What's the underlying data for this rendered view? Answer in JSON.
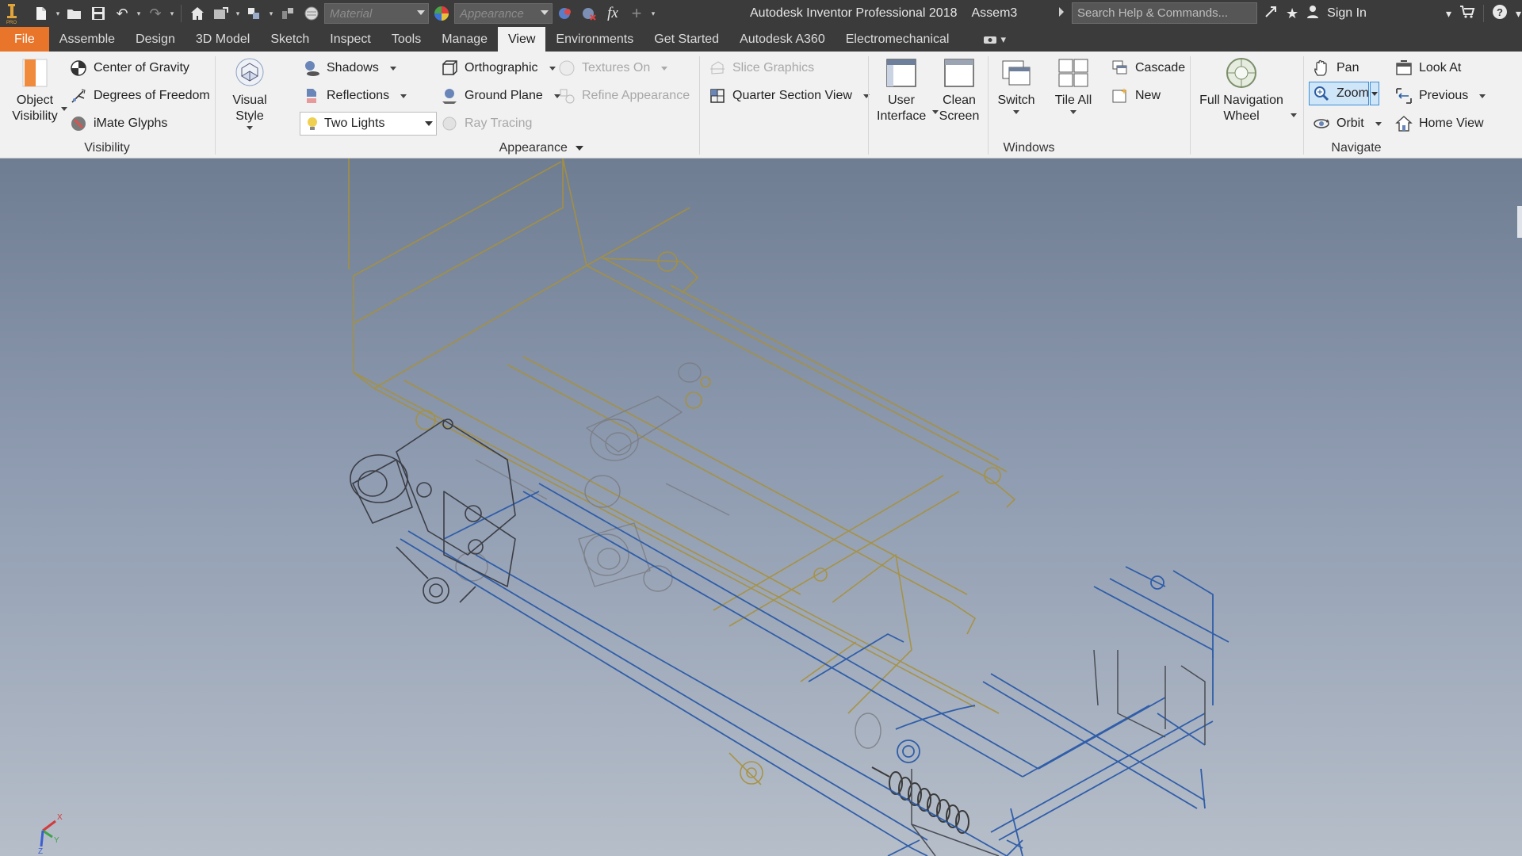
{
  "titlebar": {
    "app_name": "Autodesk Inventor Professional 2018",
    "document": "Assem3",
    "material_placeholder": "Material",
    "appearance_placeholder": "Appearance",
    "search_placeholder": "Search Help & Commands...",
    "sign_in": "Sign In",
    "fx_label": "fx"
  },
  "tabs": [
    "File",
    "Assemble",
    "Design",
    "3D Model",
    "Sketch",
    "Inspect",
    "Tools",
    "Manage",
    "View",
    "Environments",
    "Get Started",
    "Autodesk A360",
    "Electromechanical"
  ],
  "active_tab": "View",
  "ribbon": {
    "visibility": {
      "title": "Visibility",
      "object_visibility": [
        "Object",
        "Visibility"
      ],
      "center_of_gravity": "Center of Gravity",
      "degrees_of_freedom": "Degrees of Freedom",
      "imate_glyphs": "iMate Glyphs"
    },
    "appearance": {
      "title": "Appearance",
      "visual_style": "Visual Style",
      "shadows": "Shadows",
      "reflections": "Reflections",
      "lighting": "Two Lights",
      "orthographic": "Orthographic",
      "ground_plane": "Ground Plane",
      "textures_on": "Textures On",
      "refine_appearance": "Refine Appearance",
      "ray_tracing": "Ray Tracing",
      "slice_graphics": "Slice Graphics",
      "quarter_section_view": "Quarter Section View"
    },
    "windows": {
      "title": "Windows",
      "user_interface": [
        "User",
        "Interface"
      ],
      "clean_screen": [
        "Clean",
        "Screen"
      ],
      "switch": "Switch",
      "tile_all": "Tile All",
      "cascade": "Cascade",
      "new": "New"
    },
    "navigate": {
      "title": "Navigate",
      "full_navigation_wheel": [
        "Full Navigation",
        "Wheel"
      ],
      "pan": "Pan",
      "zoom": "Zoom",
      "orbit": "Orbit",
      "look_at": "Look At",
      "previous": "Previous",
      "home_view": "Home View"
    }
  },
  "colors": {
    "file_tab": "#e8752a",
    "frame_dark": "#3b3b3b",
    "ribbon_bg": "#f1f1f1",
    "model_gold": "#a8913a",
    "model_blue": "#2a5aa8"
  },
  "viewport": {
    "triad_labels": [
      "X",
      "Y",
      "Z"
    ]
  }
}
